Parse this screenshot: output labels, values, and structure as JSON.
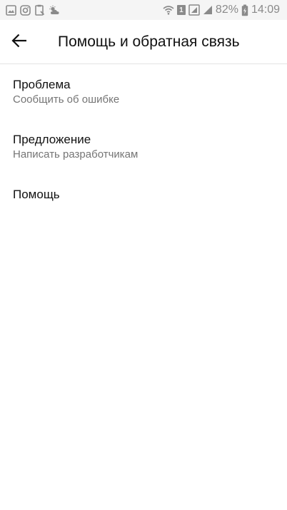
{
  "status_bar": {
    "battery_percent": "82%",
    "time": "14:09",
    "sim_label": "1",
    "left_icons": [
      "image-icon",
      "instagram-icon",
      "clipboard-icon",
      "weather-icon"
    ],
    "right_icons": [
      "wifi-icon",
      "sim-icon",
      "signal-box-icon",
      "signal-icon",
      "battery-icon"
    ]
  },
  "app_bar": {
    "title": "Помощь и обратная связь",
    "back_icon": "arrow-left-icon"
  },
  "menu": {
    "items": [
      {
        "title": "Проблема",
        "subtitle": "Сообщить об ошибке"
      },
      {
        "title": "Предложение",
        "subtitle": "Написать разработчикам"
      },
      {
        "title": "Помощь"
      }
    ]
  },
  "colors": {
    "status_bar_bg": "#f5f5f5",
    "status_icons": "#8a8a8a",
    "primary_text": "#111111",
    "secondary_text": "#757575",
    "divider": "#e3e3e3",
    "background": "#ffffff"
  }
}
